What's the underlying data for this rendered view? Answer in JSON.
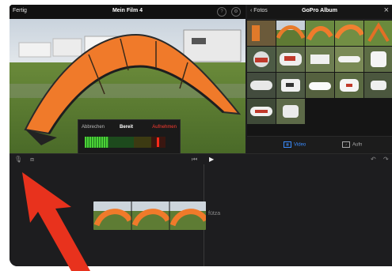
{
  "header": {
    "done_label": "Fertig",
    "title": "Mein Film 4"
  },
  "recorder": {
    "cancel_label": "Abbrechen",
    "status_label": "Bereit",
    "record_label": "Aufnehmen",
    "level": 0.45
  },
  "browser": {
    "back_label": "Fotos",
    "title": "GoPro Album",
    "tabs": [
      {
        "label": "Video",
        "active": true
      },
      {
        "label": "Aufn",
        "active": false
      }
    ]
  },
  "timeline": {
    "clip_label": "fütza"
  },
  "icons": {
    "done": "done-button",
    "help": "help-icon",
    "settings": "gear-icon",
    "back": "chevron-left-icon",
    "close": "close-icon",
    "microphone": "microphone-icon",
    "camera": "camera-icon",
    "skip_back": "skip-back-icon",
    "play": "play-icon",
    "undo": "undo-icon",
    "redo": "redo-icon",
    "video_tab": "film-icon",
    "audio_tab": "audio-icon"
  },
  "colors": {
    "accent": "#3a8cff",
    "record": "#ff3b30",
    "kite": "#f07a2a",
    "annotation_arrow": "#e8321d"
  }
}
